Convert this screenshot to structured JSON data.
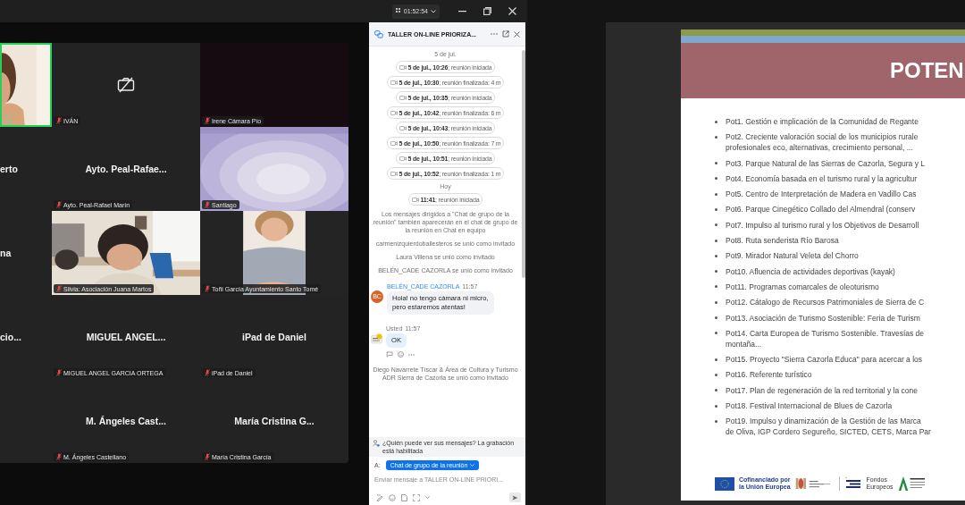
{
  "top_bar": {
    "timer": "01:52:54"
  },
  "video_tiles": [
    {
      "kind": "video",
      "speaking": true
    },
    {
      "kind": "camera_off",
      "speaking": false,
      "label": "IVÁN",
      "muted": true
    },
    {
      "kind": "dark",
      "speaking": false,
      "label": "Irene Cámara Pío",
      "muted": true
    },
    {
      "kind": "name",
      "speaking": false,
      "name": "erto"
    },
    {
      "kind": "name",
      "speaking": false,
      "name": "Ayto. Peal-Rafae...",
      "label": "Ayto. Peal-Rafael Marín",
      "muted": true
    },
    {
      "kind": "video",
      "speaking": false,
      "label": "Santiago",
      "muted": true
    },
    {
      "kind": "name",
      "speaking": false,
      "name": "na"
    },
    {
      "kind": "video",
      "speaking": false,
      "label": "Silvia: Asociación Juana Martos",
      "muted": true
    },
    {
      "kind": "video",
      "speaking": false,
      "label": "Toñi García Ayuntamiento Santo Tomé",
      "muted": true
    },
    {
      "kind": "name",
      "speaking": false,
      "name": "cio..."
    },
    {
      "kind": "name",
      "speaking": false,
      "name": "MIGUEL ANGEL...",
      "label": "MIGUEL ANGEL GARCIA ORTEGA",
      "muted": true
    },
    {
      "kind": "name",
      "speaking": false,
      "name": "iPad de Daniel",
      "label": "iPad de Daniel",
      "muted": true
    },
    {
      "kind": "empty",
      "speaking": false
    },
    {
      "kind": "name",
      "speaking": false,
      "name": "M. Ángeles Cast...",
      "label": "M. Ángeles Castellano",
      "muted": true
    },
    {
      "kind": "name",
      "speaking": false,
      "name": "María Cristina G...",
      "label": "María Cristina García",
      "muted": true
    }
  ],
  "chat": {
    "title": "TALLER ON-LINE PRIORIZA...",
    "items": [
      {
        "kind": "date",
        "text": "5 de jul."
      },
      {
        "kind": "event",
        "text": "**5 de jul., 10:26**; reunión iniciada"
      },
      {
        "kind": "event",
        "text": "**5 de jul., 10:30**; reunión finalizada: 4 m"
      },
      {
        "kind": "event",
        "text": "**5 de jul., 10:35**; reunión iniciada"
      },
      {
        "kind": "event",
        "text": "**5 de jul., 10:42**; reunión finalizada: 6 m"
      },
      {
        "kind": "event",
        "text": "**5 de jul., 10:43**; reunión iniciada"
      },
      {
        "kind": "event",
        "text": "**5 de jul., 10:50**; reunión finalizada: 7 m"
      },
      {
        "kind": "event",
        "text": "**5 de jul., 10:51**; reunión iniciada"
      },
      {
        "kind": "event",
        "text": "**5 de jul., 10:52**; reunión finalizada: 1 m"
      },
      {
        "kind": "date",
        "text": "Hoy"
      },
      {
        "kind": "event",
        "text": "**11:41**; reunión iniciada"
      },
      {
        "kind": "notice",
        "text": "Los mensajes dirigidos a \"Chat de grupo de la reunión\" también aparecerán en el chat de grupo de la reunión en Chat en equipo"
      },
      {
        "kind": "notice",
        "text": "carmenizquierdoballesteros se unió como invitado"
      },
      {
        "kind": "notice",
        "text": "Laura Villena se unió como invitado"
      },
      {
        "kind": "notice",
        "text": "BELÉN_CADE CAZORLA se unió como invitado"
      },
      {
        "kind": "message",
        "own": false,
        "avatar": "BC",
        "sender": "BELÉN_CADE CAZORLA",
        "time": "11:57",
        "text": "Hola! no tengo cámara ni micro, pero estaremos atentas!"
      },
      {
        "kind": "message",
        "own": true,
        "sender": "Usted",
        "time": "11:57",
        "text": "OK"
      },
      {
        "kind": "notice",
        "text": "Diego Navarrete Tíscar & Área de Cultura y Turismo ADR Sierra de Cazorla se unió como invitado"
      }
    ],
    "info": "¿Quién puede ver sus mensajes? La grabación está habilitada",
    "recipient_label": "A:",
    "recipient": "Chat de grupo de la reunión",
    "input": {
      "placeholder": "Enviar mensaje a TALLER ON-LINE PRIORI..."
    }
  },
  "slide": {
    "title": "POTEN",
    "items": [
      {
        "lines": [
          "Pot1. Gestión e implicación de la Comunidad de Regante"
        ]
      },
      {
        "lines": [
          "Pot2. Creciente valoración social de los municipios rurale",
          "profesionales eco, alternativas, crecimiento personal, ..."
        ]
      },
      {
        "lines": [
          "Pot3. Parque Natural de las Sierras de Cazorla, Segura y L"
        ]
      },
      {
        "lines": [
          "Pot4. Economía basada en el turismo rural y la agricultur"
        ]
      },
      {
        "lines": [
          "Pot5. Centro de Interpretación de Madera en Vadillo Cas"
        ]
      },
      {
        "lines": [
          "Pot6. Parque Cinegético Collado del Almendral (conserv"
        ]
      },
      {
        "lines": [
          "Pot7. Impulso al turismo rural y los Objetivos de Desarroll"
        ]
      },
      {
        "lines": [
          "Pot8. Ruta senderista Río Barosa"
        ]
      },
      {
        "lines": [
          "Pot9. Mirador Natural Veleta del Chorro"
        ]
      },
      {
        "lines": [
          "Pot10. Afluencia de actividades deportivas (kayak)"
        ]
      },
      {
        "lines": [
          "Pot11. Programas comarcales de oleoturismo"
        ]
      },
      {
        "lines": [
          "Pot12. Cátalogo de Recursos Patrimoniales de Sierra de C"
        ]
      },
      {
        "lines": [
          "Pot13. Asociación de Turismo Sostenible: Feria de Turism"
        ]
      },
      {
        "lines": [
          "Pot14. Carta Europea de Turismo Sostenible. Travesías de",
          "montaña..."
        ]
      },
      {
        "lines": [
          "Pot15. Proyecto \"Sierra Cazorla Educa\" para acercar a los"
        ]
      },
      {
        "lines": [
          "Pot16. Referente turístico"
        ]
      },
      {
        "lines": [
          "Pot17. Plan de regeneración de la red territorial y la cone"
        ]
      },
      {
        "lines": [
          "Pot18. Festival Internacional de Blues de Cazorla"
        ]
      },
      {
        "lines": [
          "Pot19. Impulso y dinamización de la Gestión de las Marca",
          "de Oliva,  IGP Cordero Segureño, SICTED, CETS, Marca Par"
        ]
      }
    ],
    "logos": [
      {
        "kind": "eu",
        "lines": [
          "Cofinanciado por",
          "la Unión Europea"
        ]
      },
      {
        "kind": "ministry"
      },
      {
        "kind": "funds",
        "lines": [
          "Fondos",
          "Europeos"
        ]
      },
      {
        "kind": "junta"
      }
    ]
  }
}
